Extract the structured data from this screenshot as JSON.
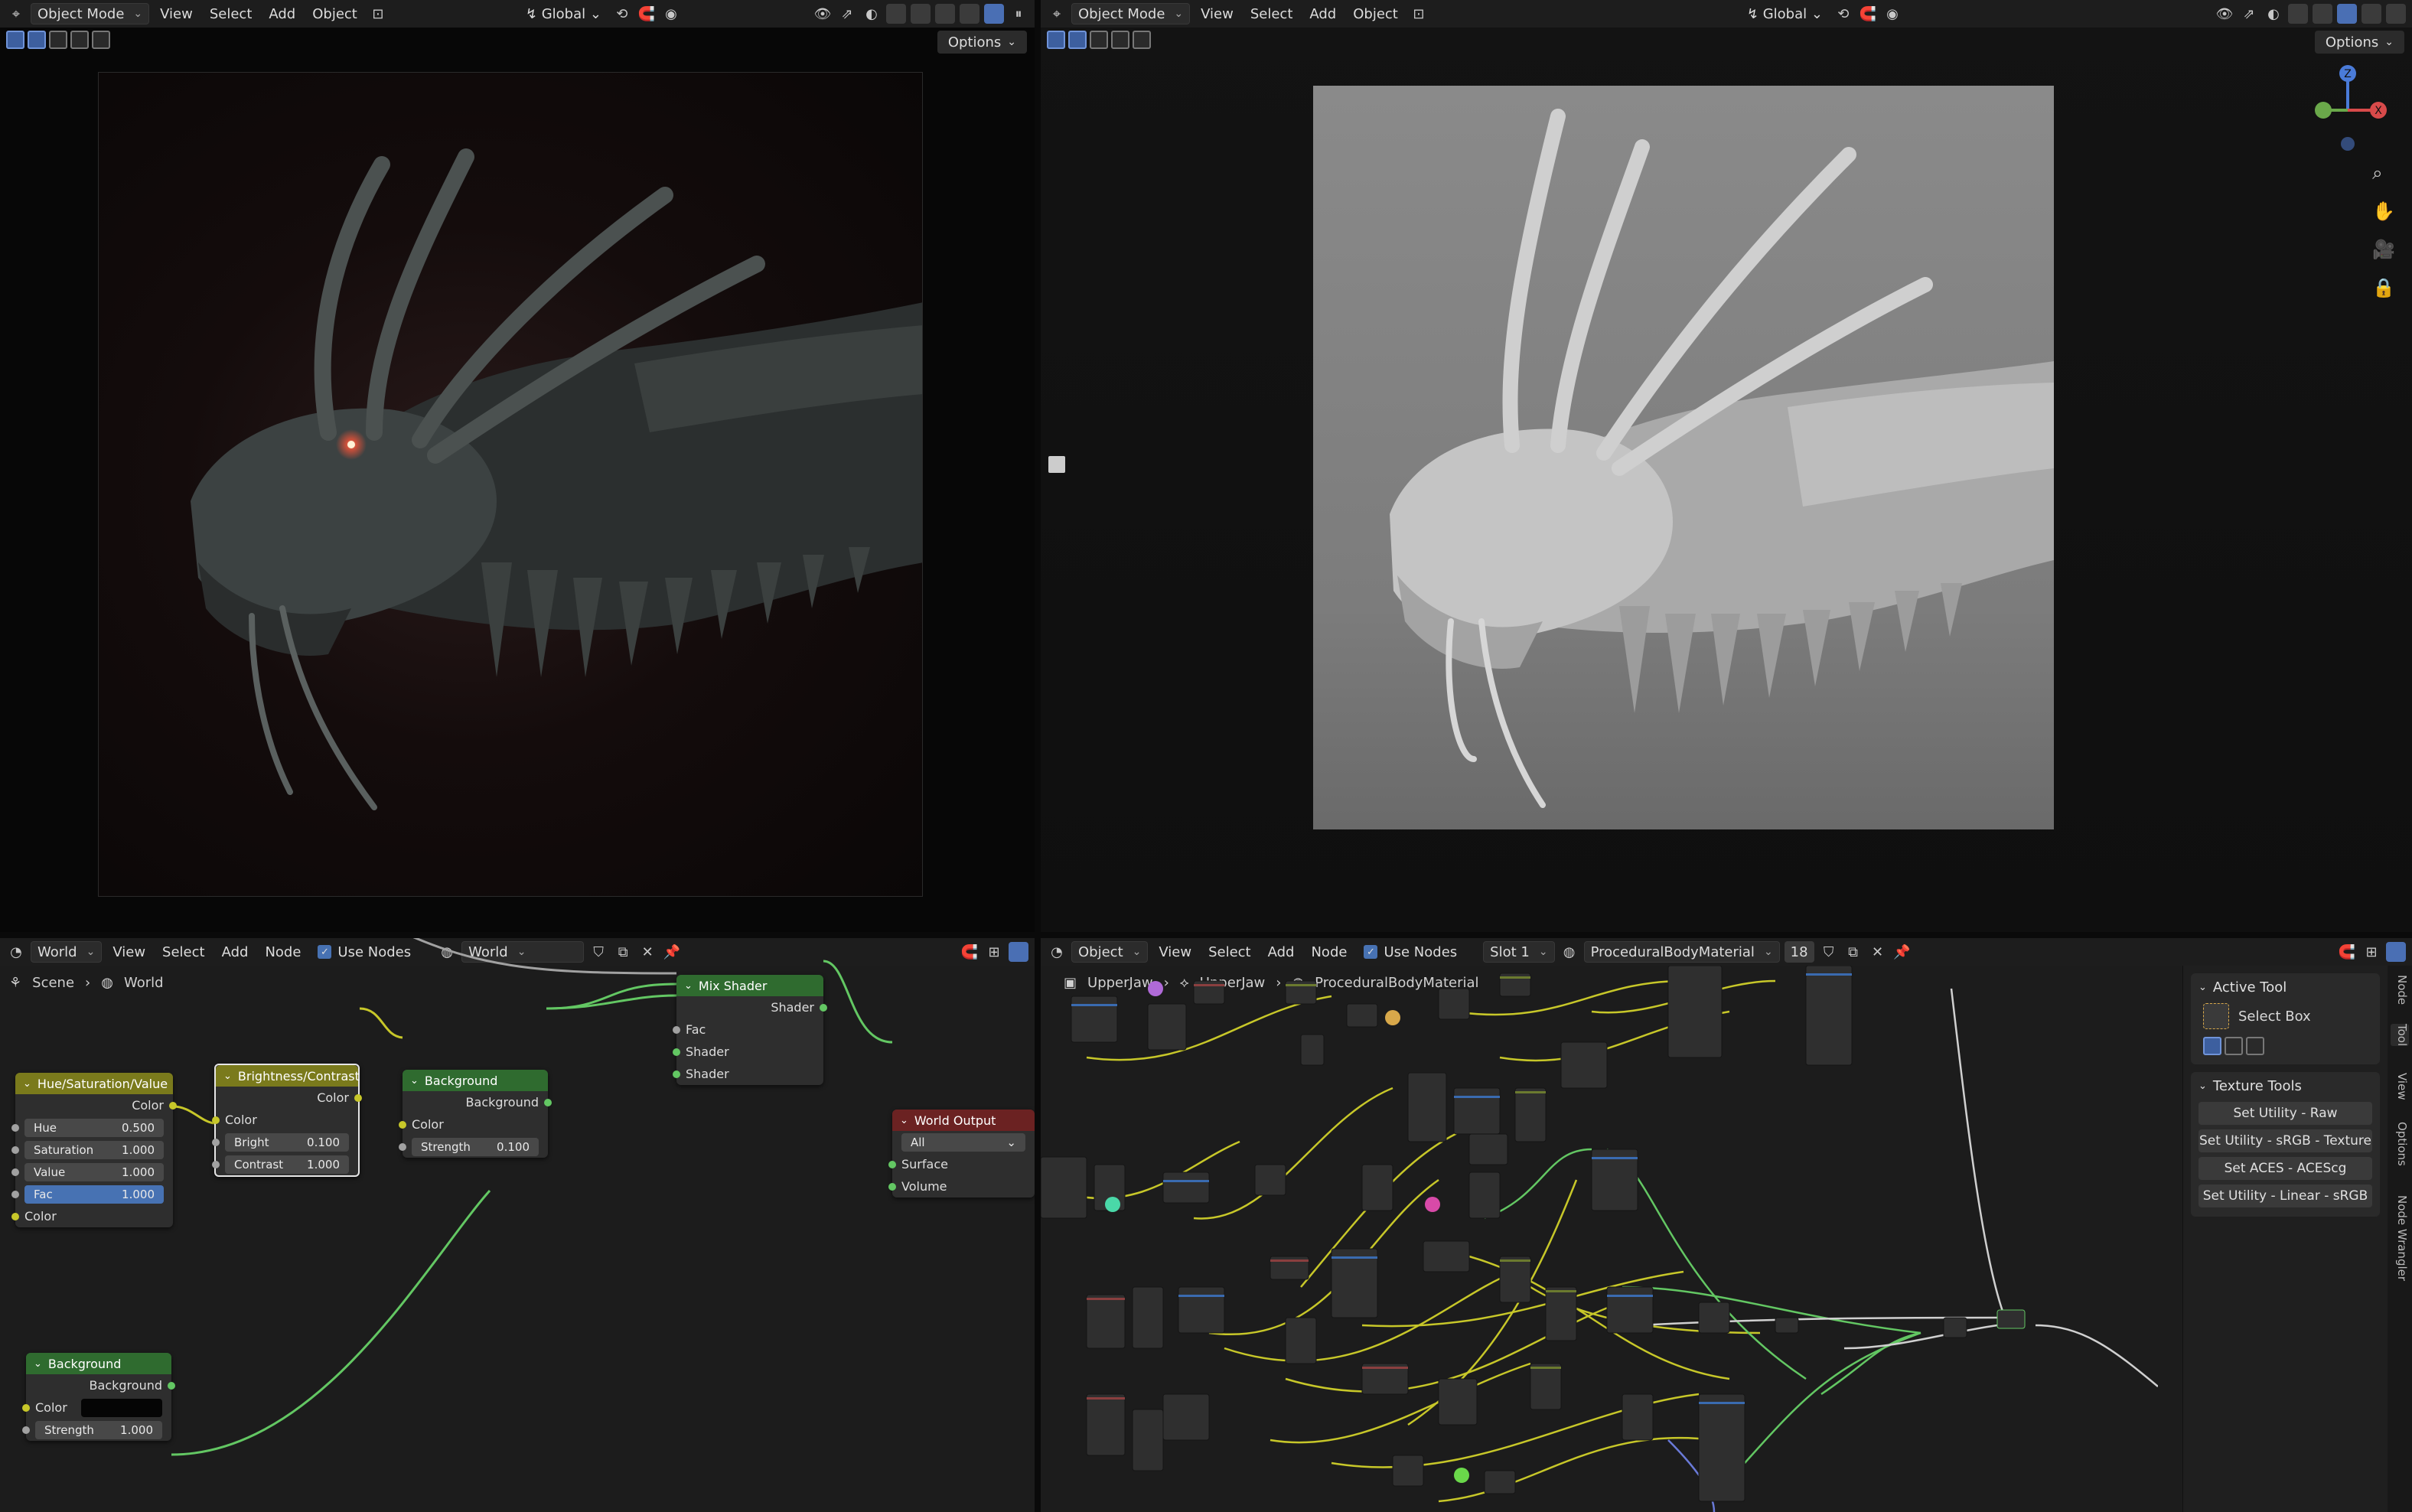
{
  "left_viewport": {
    "mode": "Object Mode",
    "menus": [
      "View",
      "Select",
      "Add",
      "Object"
    ],
    "orientation": "Global",
    "options_label": "Options"
  },
  "right_viewport": {
    "mode": "Object Mode",
    "menus": [
      "View",
      "Select",
      "Add",
      "Object"
    ],
    "orientation": "Global",
    "options_label": "Options",
    "gizmo_axes": [
      "Z",
      "X"
    ]
  },
  "left_node_editor": {
    "type": "World",
    "menus": [
      "View",
      "Select",
      "Add",
      "Node"
    ],
    "use_nodes_label": "Use Nodes",
    "world_name": "World",
    "breadcrumb": [
      "Scene",
      "World"
    ],
    "nodes": {
      "hsv": {
        "title": "Hue/Saturation/Value",
        "output": "Color",
        "fields": [
          {
            "label": "Hue",
            "value": "0.500"
          },
          {
            "label": "Saturation",
            "value": "1.000"
          },
          {
            "label": "Value",
            "value": "1.000"
          },
          {
            "label": "Fac",
            "value": "1.000"
          }
        ],
        "input": "Color"
      },
      "brightness": {
        "title": "Brightness/Contrast",
        "output": "Color",
        "input": "Color",
        "fields": [
          {
            "label": "Bright",
            "value": "0.100"
          },
          {
            "label": "Contrast",
            "value": "1.000"
          }
        ]
      },
      "background1": {
        "title": "Background",
        "output": "Background",
        "input": "Color",
        "strength_label": "Strength",
        "strength_value": "0.100"
      },
      "mix": {
        "title": "Mix Shader",
        "output": "Shader",
        "inputs": [
          "Fac",
          "Shader",
          "Shader"
        ]
      },
      "world_output": {
        "title": "World Output",
        "target": "All",
        "inputs": [
          "Surface",
          "Volume"
        ]
      },
      "background2": {
        "title": "Background",
        "output": "Background",
        "color_label": "Color",
        "strength_label": "Strength",
        "strength_value": "1.000"
      }
    }
  },
  "right_node_editor": {
    "type": "Object",
    "menus": [
      "View",
      "Select",
      "Add",
      "Node"
    ],
    "use_nodes_label": "Use Nodes",
    "slot": "Slot 1",
    "material": "ProceduralBodyMaterial",
    "users": "18",
    "breadcrumb": [
      "UpperJaw",
      "UpperJaw",
      "ProceduralBodyMaterial"
    ],
    "sidebar": {
      "active_tool_title": "Active Tool",
      "tool_name": "Select Box",
      "texture_tools_title": "Texture Tools",
      "buttons": [
        "Set Utility - Raw",
        "Set Utility - sRGB - Texture",
        "Set ACES - ACEScg",
        "Set Utility - Linear - sRGB"
      ],
      "tabs": [
        "Node",
        "Tool",
        "View",
        "Options",
        "Node Wrangler"
      ]
    }
  },
  "colors": {
    "socket_color": "#c7c729",
    "socket_shader": "#63c763",
    "accent": "#4772b3"
  }
}
